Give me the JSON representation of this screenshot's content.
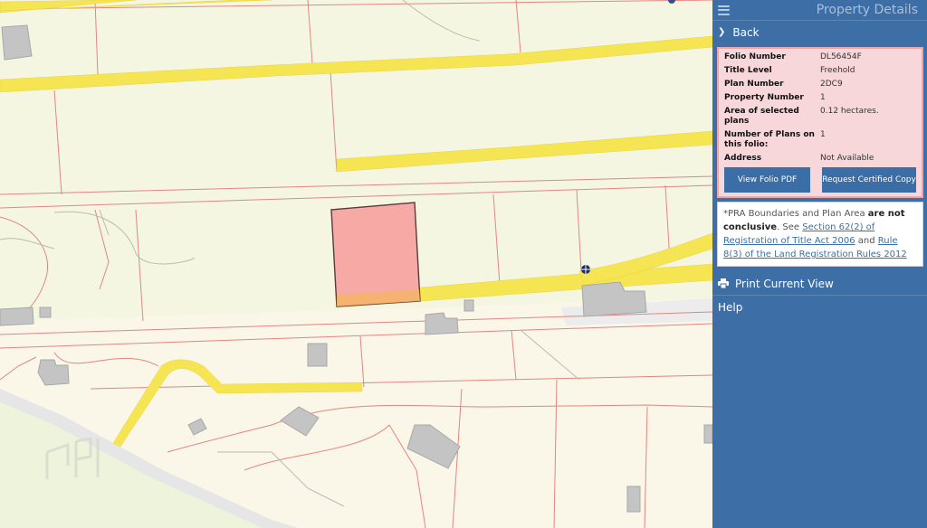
{
  "panel": {
    "title": "Property Details",
    "back_label": "Back",
    "details": [
      {
        "label": "Folio Number",
        "value": "DL56454F"
      },
      {
        "label": "Title Level",
        "value": "Freehold"
      },
      {
        "label": "Plan Number",
        "value": "2DC9"
      },
      {
        "label": "Property Number",
        "value": "1"
      },
      {
        "label": "Area of selected plans",
        "value": "0.12 hectares."
      },
      {
        "label": "Number of Plans on this folio:",
        "value": "1"
      },
      {
        "label": "Address",
        "value": "Not Available"
      }
    ],
    "view_pdf_label": "View Folio PDF",
    "request_copy_label": "Request Certified Copy",
    "notice": {
      "prefix": "*PRA Boundaries and Plan Area ",
      "bold": "are not conclusive",
      "mid": ". See ",
      "link1": "Section 62(2) of Registration of Title Act 2006",
      "and": " and ",
      "link2": "Rule 8(3) of the Land Registration Rules 2012"
    },
    "print_label": "Print Current View",
    "help_label": "Help"
  },
  "colors": {
    "panel_bg": "#3d6ea6",
    "selected_parcel": "#f7aaa5",
    "road": "#f6e553",
    "boundary": "#e07a78",
    "details_bg": "#f8d7da"
  }
}
